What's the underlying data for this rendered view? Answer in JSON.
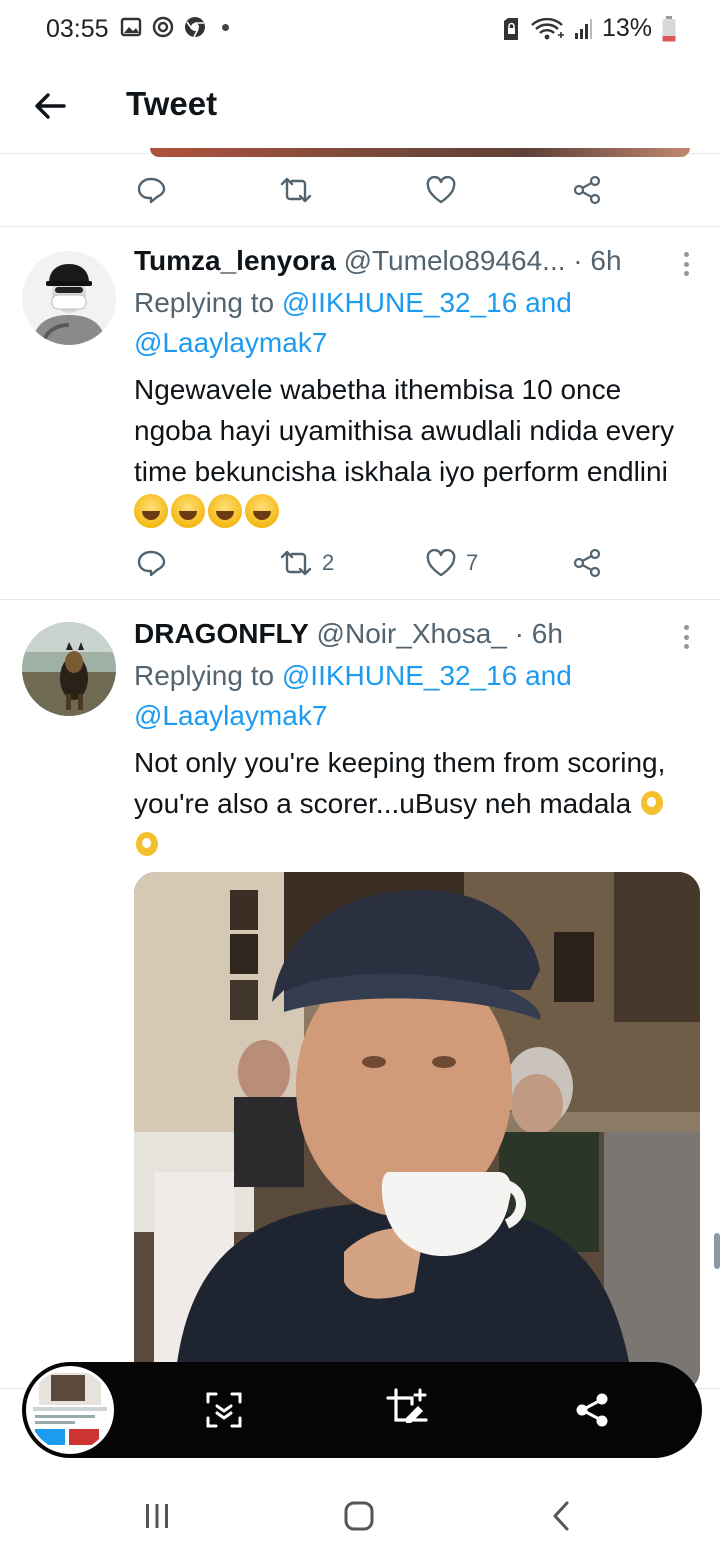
{
  "status_bar": {
    "time": "03:55",
    "battery": "13%",
    "notification_icons": [
      "gallery-icon",
      "target-icon",
      "chrome-icon",
      "dot-icon"
    ],
    "system_icons": [
      "sim-lock-icon",
      "wifi-icon",
      "signal-icon",
      "battery-icon"
    ]
  },
  "app_bar": {
    "title": "Tweet",
    "back_icon": "arrow-left-icon"
  },
  "top_actions": {
    "icons": [
      "reply-icon",
      "retweet-icon",
      "like-icon",
      "share-icon"
    ]
  },
  "tweets": [
    {
      "name": "Tumza_lenyora",
      "handle": "@Tumelo89464...",
      "separator": "·",
      "time": "6h",
      "replying_prefix": "Replying to ",
      "replying_user1": "@IIKHUNE_32_16",
      "replying_and": " and",
      "replying_user2": "@Laaylaymak7",
      "text": "Ngewavele wabetha ithembisa 10 once ngoba hayi uyamithisa awudlali ndida every time bekuncisha iskhala iyo perform endlini",
      "emojis": [
        "laughing-tears-icon",
        "laughing-tears-icon",
        "laughing-tears-icon",
        "laughing-tears-icon"
      ],
      "retweets": "2",
      "likes": "7"
    },
    {
      "name": "DRAGONFLY",
      "handle": "@Noir_Xhosa_",
      "separator": "·",
      "time": "6h",
      "replying_prefix": "Replying to ",
      "replying_user1": "@IIKHUNE_32_16",
      "replying_and": " and",
      "replying_user2": "@Laaylaymak7",
      "text": "Not only you're keeping them from scoring, you're  also a scorer...uBusy neh madala",
      "emojis": [
        "ok-hand-icon",
        "ok-hand-icon"
      ],
      "media_alt": "photo"
    }
  ],
  "screenshot_toolbar": {
    "icons": [
      "scroll-capture-icon",
      "crop-edit-icon",
      "share-icon"
    ]
  },
  "nav_bar": {
    "icons": [
      "recents-icon",
      "home-icon",
      "back-icon"
    ]
  },
  "colors": {
    "link": "#1d9bf0",
    "secondary_text": "#536471",
    "toolbar_bg": "#050505"
  }
}
